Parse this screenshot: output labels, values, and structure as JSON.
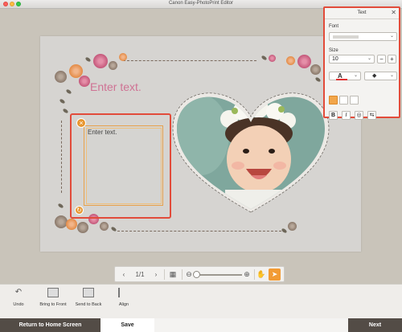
{
  "window": {
    "title": "Canon Easy-PhotoPrint Editor"
  },
  "canvas": {
    "title_text": "Enter text.",
    "selected_text": "Enter text."
  },
  "zoom_toolbar": {
    "page_indicator": "1/1"
  },
  "text_panel": {
    "title": "Text",
    "font_label": "Font",
    "font_value": "",
    "size_label": "Size",
    "size_value": "10",
    "text_color": "#e03030",
    "style_buttons": [
      "B",
      "I"
    ]
  },
  "toolbar": {
    "undo": "Undo",
    "bring_to_front": "Bring to Front",
    "send_to_back": "Send to Back",
    "align": "Align"
  },
  "footer": {
    "home": "Return to Home Screen",
    "save": "Save",
    "next": "Next"
  },
  "colors": {
    "selection": "#e24b3a",
    "accent": "#f29b34",
    "footer_dark": "#534c46",
    "canvas_text": "#cf7294"
  }
}
